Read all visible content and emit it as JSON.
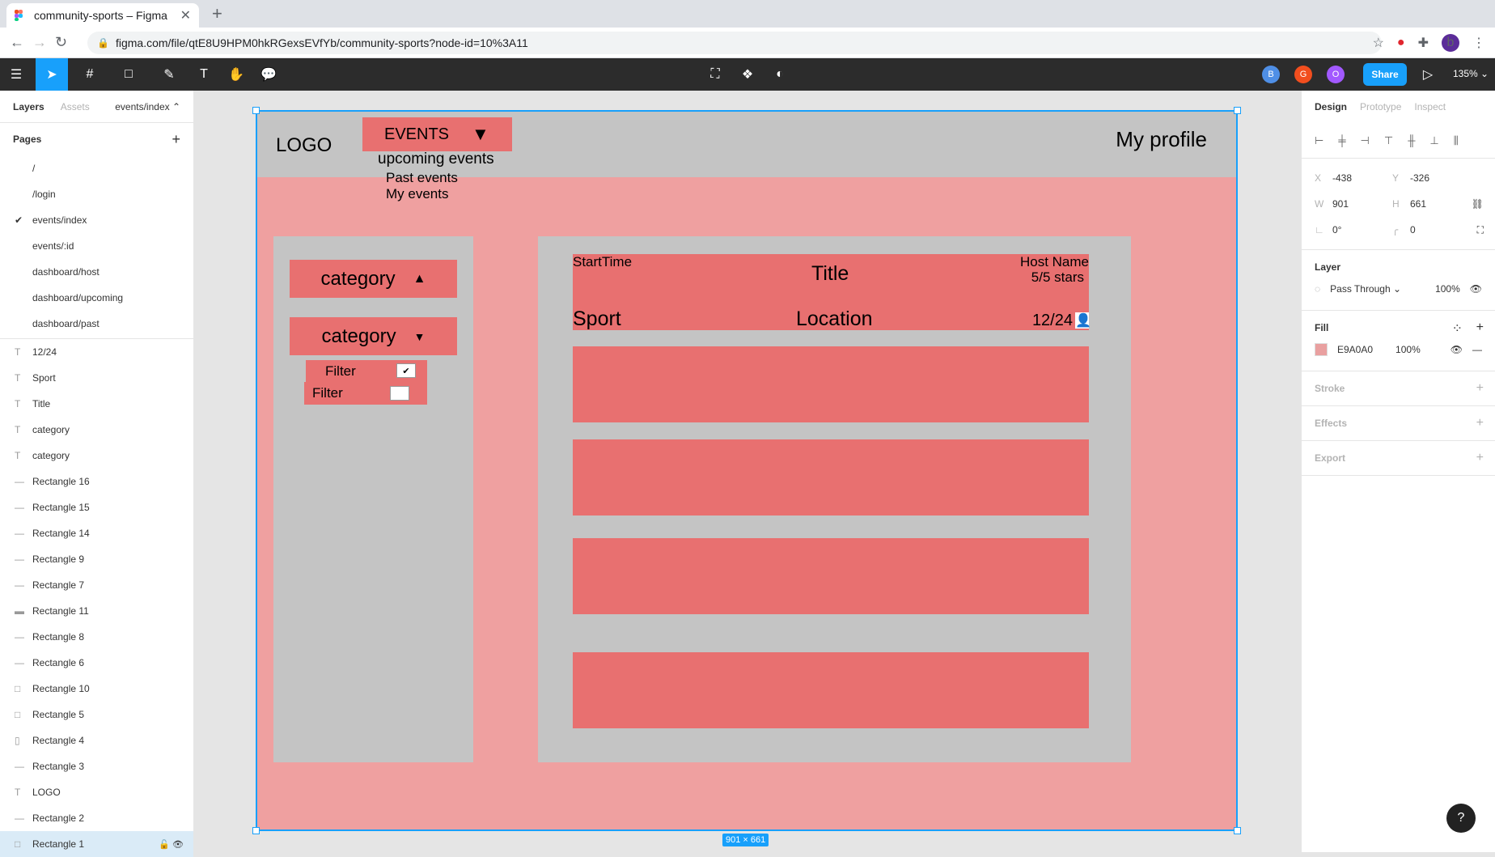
{
  "browser": {
    "tab_title": "community-sports – Figma",
    "tab_close": "✕",
    "new_tab": "+",
    "url": "figma.com/file/qtE8U9HPM0hkRGexsEVfYb/community-sports?node-id=10%3A11",
    "profile_initial": "b"
  },
  "toolbar": {
    "share_label": "Share",
    "zoom": "135%",
    "collaborators": [
      {
        "initial": "B",
        "color": "#4f8fe6"
      },
      {
        "initial": "G",
        "color": "#f24e1e"
      },
      {
        "initial": "O",
        "color": "#a259ff"
      }
    ]
  },
  "left_panel": {
    "tab_layers": "Layers",
    "tab_assets": "Assets",
    "page_selector": "events/index ⌃",
    "pages_title": "Pages",
    "pages": [
      "/",
      "/login",
      "events/index",
      "events/:id",
      "dashboard/host",
      "dashboard/upcoming",
      "dashboard/past"
    ],
    "current_page_index": 2,
    "layers": [
      {
        "name": "12/24",
        "icon": "T"
      },
      {
        "name": "Sport",
        "icon": "T"
      },
      {
        "name": "Title",
        "icon": "T"
      },
      {
        "name": "category",
        "icon": "T"
      },
      {
        "name": "category",
        "icon": "T"
      },
      {
        "name": "Rectangle 16",
        "icon": "—"
      },
      {
        "name": "Rectangle 15",
        "icon": "—"
      },
      {
        "name": "Rectangle 14",
        "icon": "—"
      },
      {
        "name": "Rectangle 9",
        "icon": "—"
      },
      {
        "name": "Rectangle 7",
        "icon": "—"
      },
      {
        "name": "Rectangle 11",
        "icon": "▬"
      },
      {
        "name": "Rectangle 8",
        "icon": "—"
      },
      {
        "name": "Rectangle 6",
        "icon": "—"
      },
      {
        "name": "Rectangle 10",
        "icon": "□"
      },
      {
        "name": "Rectangle 5",
        "icon": "□"
      },
      {
        "name": "Rectangle 4",
        "icon": "▯"
      },
      {
        "name": "Rectangle 3",
        "icon": "—"
      },
      {
        "name": "LOGO",
        "icon": "T"
      },
      {
        "name": "Rectangle 2",
        "icon": "—"
      },
      {
        "name": "Rectangle 1",
        "icon": "□"
      }
    ],
    "selected_layer": "Rectangle 1"
  },
  "canvas": {
    "logo": "LOGO",
    "events_button": "EVENTS",
    "events_arrow": "▼",
    "my_profile": "My profile",
    "dropdown": [
      "upcoming events",
      "Past events",
      "My events"
    ],
    "category_1": "category",
    "category_1_arrow": "▲",
    "category_2": "category",
    "category_2_arrow": "▼",
    "filter_1": "Filter",
    "filter_1_check": "✔",
    "filter_2": "Filter",
    "card": {
      "start_time": "StartTime",
      "title": "Title",
      "host_name": "Host Name",
      "stars": "5/5 stars",
      "sport": "Sport",
      "location": "Location",
      "count": "12/24",
      "person_icon": "👤"
    },
    "size_badge": "901 × 661",
    "frame_color": "#efa0a0",
    "accent_color": "#e87070"
  },
  "right_panel": {
    "tab_design": "Design",
    "tab_prototype": "Prototype",
    "tab_inspect": "Inspect",
    "x_label": "X",
    "x_value": "-438",
    "y_label": "Y",
    "y_value": "-326",
    "w_label": "W",
    "w_value": "901",
    "h_label": "H",
    "h_value": "661",
    "rotation": "0°",
    "radius": "0",
    "layer_title": "Layer",
    "blend_mode": "Pass Through",
    "opacity": "100%",
    "fill_title": "Fill",
    "fill_hex": "E9A0A0",
    "fill_opacity": "100%",
    "stroke_title": "Stroke",
    "effects_title": "Effects",
    "export_title": "Export"
  },
  "help": "?"
}
